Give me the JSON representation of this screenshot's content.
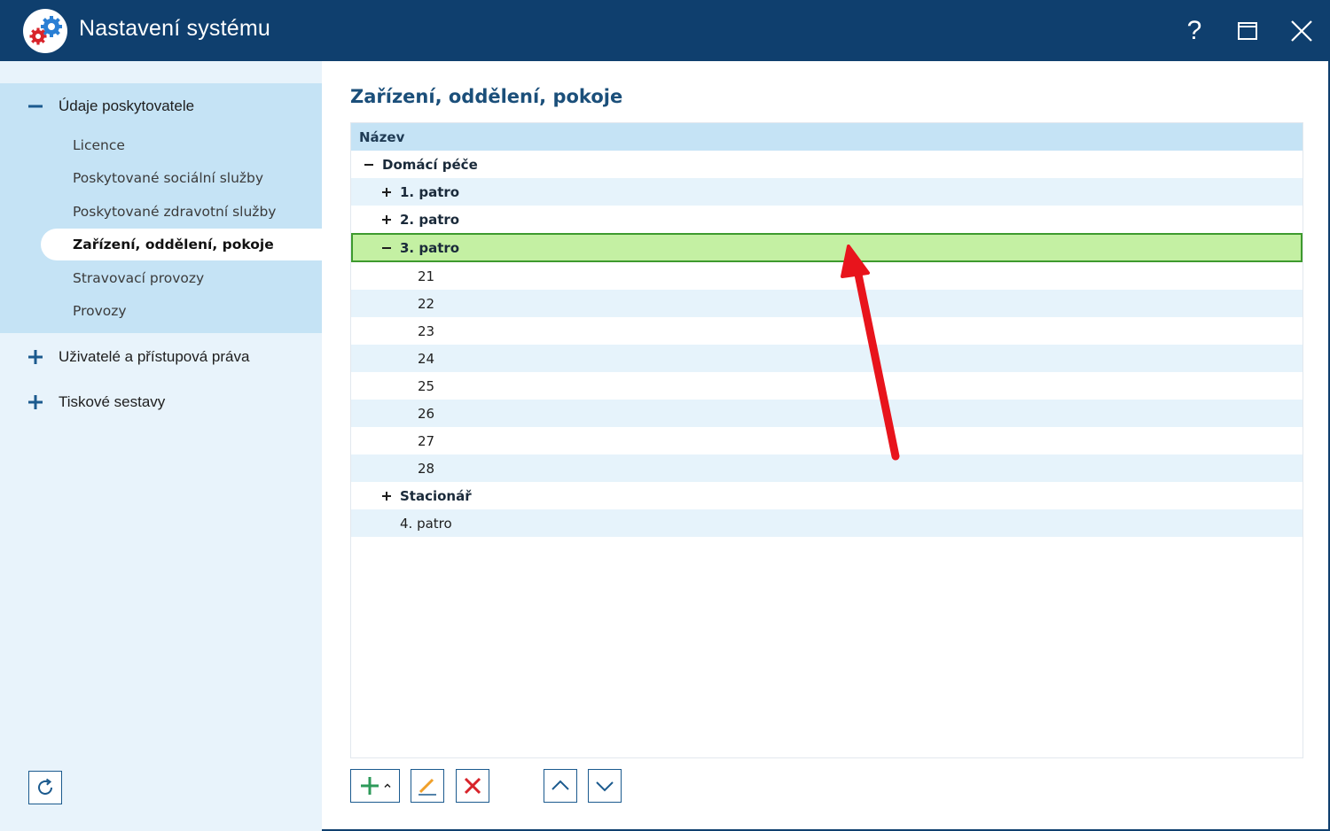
{
  "window": {
    "title": "Nastavení systému",
    "help_label": "?"
  },
  "sidebar": {
    "groups": [
      {
        "label": "Údaje poskytovatele",
        "expanded": true,
        "items": [
          {
            "label": "Licence"
          },
          {
            "label": "Poskytované sociální služby"
          },
          {
            "label": "Poskytované zdravotní služby"
          },
          {
            "label": "Zařízení, oddělení, pokoje",
            "active": true
          },
          {
            "label": "Stravovací provozy"
          },
          {
            "label": "Provozy"
          }
        ]
      },
      {
        "label": "Uživatelé a přístupová práva",
        "expanded": false
      },
      {
        "label": "Tiskové sestavy",
        "expanded": false
      }
    ]
  },
  "main": {
    "title": "Zařízení, oddělení, pokoje",
    "grid": {
      "column_header": "Název",
      "rows": [
        {
          "label": "Domácí péče",
          "toggle": "minus"
        },
        {
          "label": "1. patro",
          "toggle": "plus"
        },
        {
          "label": "2. patro",
          "toggle": "plus"
        },
        {
          "label": "3. patro",
          "toggle": "minus",
          "selected": true
        },
        {
          "label": "21"
        },
        {
          "label": "22"
        },
        {
          "label": "23"
        },
        {
          "label": "24"
        },
        {
          "label": "25"
        },
        {
          "label": "26"
        },
        {
          "label": "27"
        },
        {
          "label": "28"
        },
        {
          "label": "Stacionář",
          "toggle": "plus"
        },
        {
          "label": "4. patro"
        }
      ]
    }
  },
  "colors": {
    "titlebar": "#0f3f6e",
    "accent_blue": "#1b5a8e",
    "selected_row": "#c4f0a3",
    "selected_border": "#3e9a2e",
    "add_green": "#2e9a5a",
    "delete_red": "#d8232a",
    "edit_orange": "#f0a02a",
    "annotation_arrow": "#e8141c"
  }
}
